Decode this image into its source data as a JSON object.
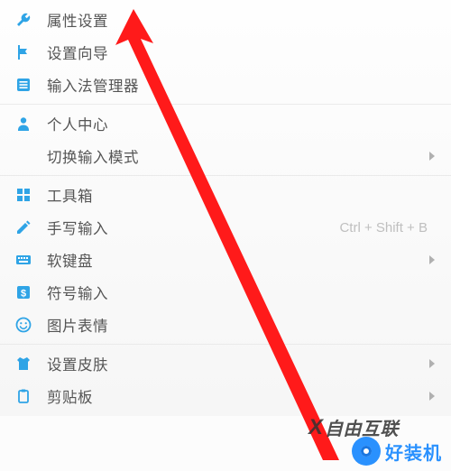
{
  "menu": {
    "items": [
      {
        "id": "properties",
        "icon": "wrench-icon",
        "label": "属性设置",
        "has_submenu": false
      },
      {
        "id": "wizard",
        "icon": "flag-icon",
        "label": "设置向导",
        "has_submenu": false
      },
      {
        "id": "ime-manager",
        "icon": "list-icon",
        "label": "输入法管理器",
        "has_submenu": false
      },
      {
        "type": "separator"
      },
      {
        "id": "user-center",
        "icon": "person-icon",
        "label": "个人中心",
        "has_submenu": false
      },
      {
        "id": "switch-mode",
        "icon": "",
        "label": "切换输入模式",
        "has_submenu": true
      },
      {
        "type": "separator"
      },
      {
        "id": "toolbox",
        "icon": "grid-icon",
        "label": "工具箱",
        "has_submenu": false
      },
      {
        "id": "handwriting",
        "icon": "pencil-icon",
        "label": "手写输入",
        "shortcut": "Ctrl + Shift + B",
        "has_submenu": false
      },
      {
        "id": "soft-keyboard",
        "icon": "keyboard-icon",
        "label": "软键盘",
        "has_submenu": true
      },
      {
        "id": "symbol-input",
        "icon": "dollar-icon",
        "label": "符号输入",
        "has_submenu": false
      },
      {
        "id": "emoji",
        "icon": "smile-icon",
        "label": "图片表情",
        "has_submenu": false
      },
      {
        "type": "separator"
      },
      {
        "id": "skin",
        "icon": "shirt-icon",
        "label": "设置皮肤",
        "has_submenu": true
      },
      {
        "id": "clipboard",
        "icon": "clipboard-icon",
        "label": "剪贴板",
        "has_submenu": true
      }
    ]
  },
  "watermarks": {
    "w1": "自由互联",
    "w2": "好装机"
  },
  "colors": {
    "icon": "#2fa4e6",
    "text": "#555555",
    "shortcut": "#bfbfbf",
    "arrow_annotation": "#ff0000"
  }
}
